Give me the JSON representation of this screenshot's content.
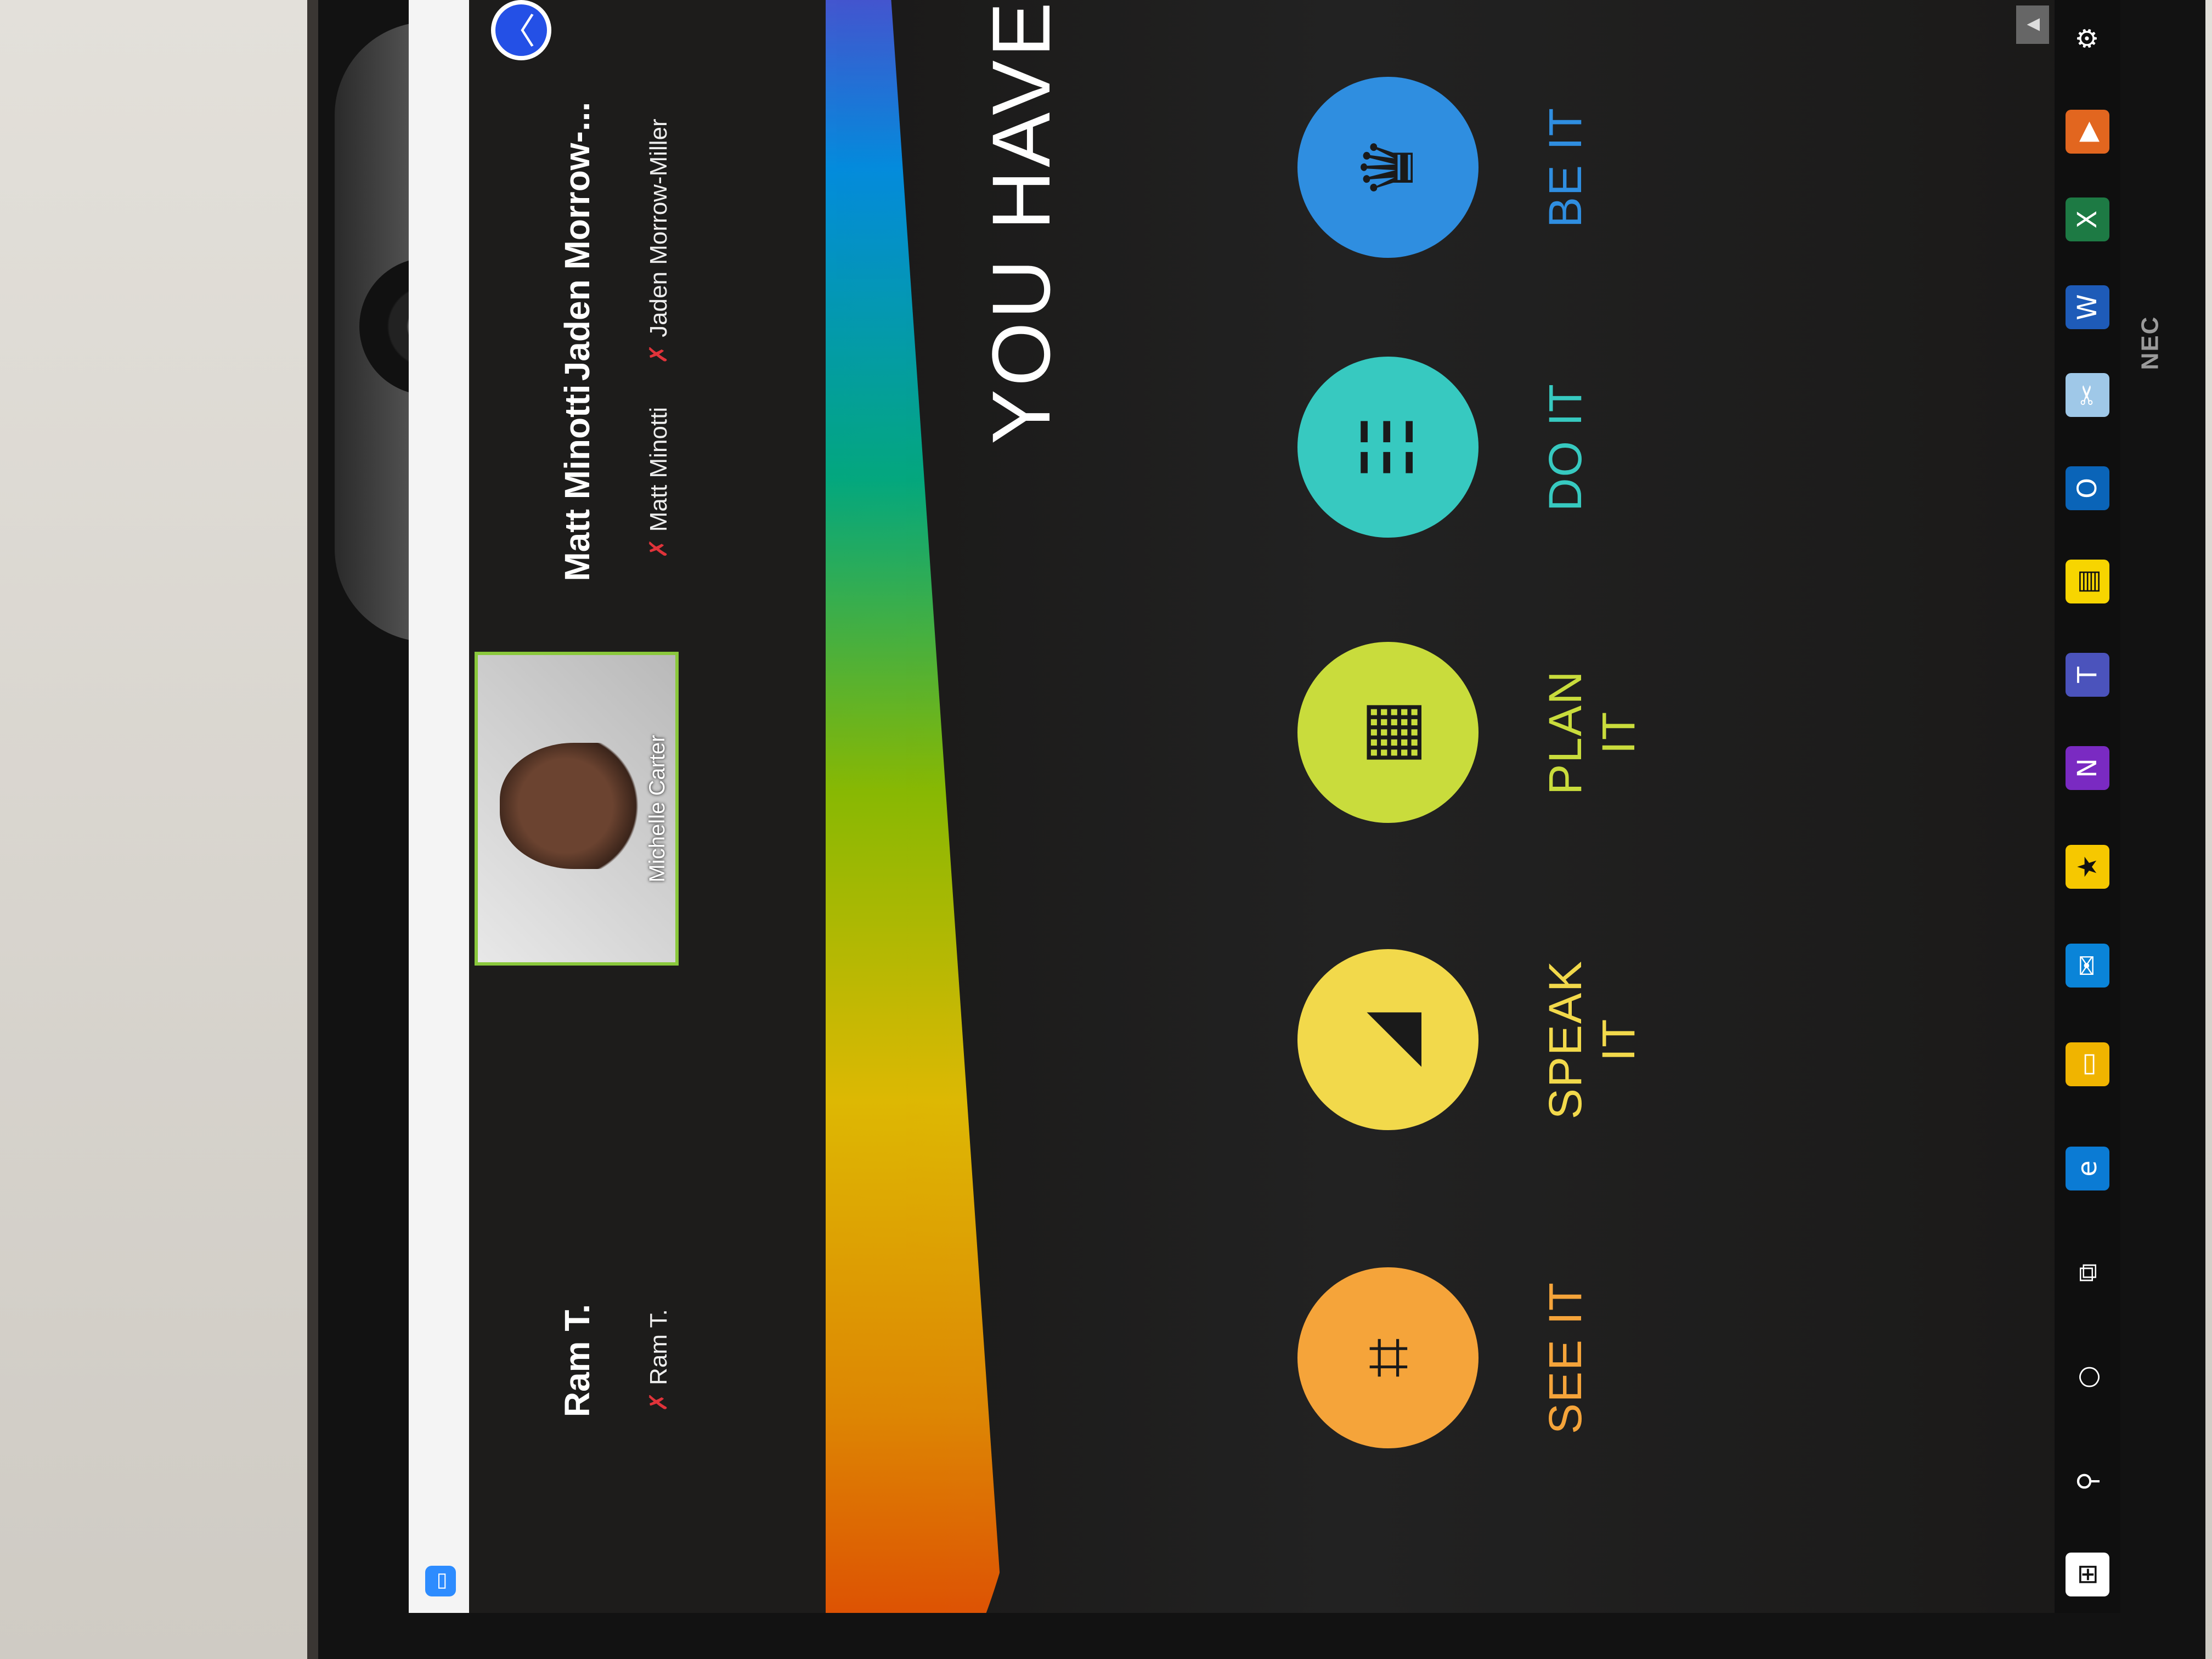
{
  "device": {
    "brand": "NEC"
  },
  "meeting": {
    "participants": [
      {
        "display_name": "Ram T.",
        "sub_name": "Ram T."
      },
      {
        "display_name": "Matt Minotti",
        "sub_name": "Matt Minotti"
      },
      {
        "display_name": "Jaden  Morrow-...",
        "sub_name": "Jaden Morrow-Miller"
      }
    ],
    "video_tile": {
      "name": "Michelle Carter"
    }
  },
  "slide": {
    "headline": "YOU HAVE TO...",
    "steps": [
      {
        "label": "SEE IT",
        "color": "#f5a43a",
        "label_color": "#f5a43a",
        "icon": "binoculars-icon"
      },
      {
        "label": "SPEAK IT",
        "color": "#f2d94b",
        "label_color": "#f2d94b",
        "icon": "speaker-icon"
      },
      {
        "label": "PLAN IT",
        "color": "#c9dc3c",
        "label_color": "#c9dc3c",
        "icon": "calendar-icon"
      },
      {
        "label": "DO IT",
        "color": "#37c9c0",
        "label_color": "#37c9c0",
        "icon": "checklist-icon"
      },
      {
        "label": "BE IT",
        "color": "#2f8ee0",
        "label_color": "#2f8ee0",
        "icon": "trophy-icon"
      }
    ]
  },
  "taskbar": {
    "items": [
      "windows-start-icon",
      "search-icon",
      "cortana-icon",
      "task-view-icon",
      "edge-icon",
      "file-explorer-icon",
      "mail-icon",
      "discover-app-icon",
      "onenote-icon",
      "teams-icon",
      "sticky-notes-icon",
      "outlook-icon",
      "snip-tool-icon",
      "word-icon",
      "excel-icon",
      "zoom-icon",
      "settings-icon"
    ]
  }
}
